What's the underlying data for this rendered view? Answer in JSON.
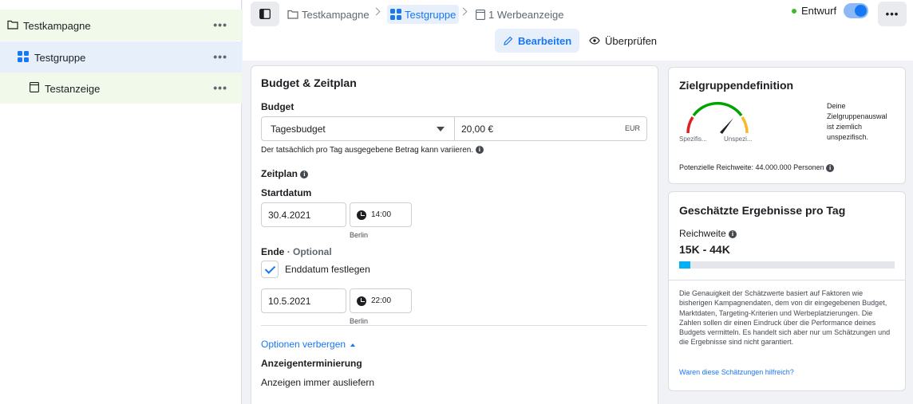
{
  "sidebar": {
    "items": [
      {
        "label": "Testkampagne",
        "more": "•••"
      },
      {
        "label": "Testgruppe",
        "more": "•••"
      },
      {
        "label": "Testanzeige",
        "more": "•••"
      }
    ]
  },
  "topbar": {
    "breadcrumbs": [
      "Testkampagne",
      "Testgruppe",
      "1 Werbeanzeige"
    ],
    "status": "Entwurf",
    "status_toggle_on": true,
    "more": "•••",
    "tabs": [
      "Bearbeiten",
      "Überprüfen"
    ],
    "active_tab": "Bearbeiten"
  },
  "budget_card": {
    "title": "Budget & Zeitplan",
    "budget_label": "Budget",
    "budget_type": "Tagesbudget",
    "budget_amount": "20,00 €",
    "currency": "EUR",
    "budget_note": "Der tatsächlich pro Tag ausgegebene Betrag kann variieren.",
    "schedule_label": "Zeitplan",
    "start_label": "Startdatum",
    "start_date": "30.4.2021",
    "start_time": "14:00",
    "start_tz": "Berlin",
    "end_label": "Ende",
    "end_optional": "· Optional",
    "end_checkbox_label": "Enddatum festlegen",
    "end_checked": true,
    "end_date": "10.5.2021",
    "end_time": "22:00",
    "end_tz": "Berlin",
    "options_link": "Optionen verbergen",
    "delivery_label": "Anzeigenterminierung",
    "delivery_value": "Anzeigen immer ausliefern"
  },
  "audience_card": {
    "title": "Zielgruppendefinition",
    "gauge_left": "Spezifis...",
    "gauge_right": "Unspezi...",
    "description": [
      "Deine",
      "Zielgruppenauswal",
      "ist ziemlich",
      "unspezifisch."
    ],
    "reach_text": "Potenzielle Reichweite: 44.000.000 Personen",
    "colors": {
      "specific": "#e02020",
      "good": "#00a400",
      "broad": "#f7b928"
    }
  },
  "estimate_card": {
    "title": "Geschätzte Ergebnisse pro Tag",
    "reach_label": "Reichweite",
    "reach_value": "15K - 44K",
    "bar_fill_fraction": 0.05,
    "disclaimer": "Die Genauigkeit der Schätzwerte basiert auf Faktoren wie bisherigen Kampagnendaten, dem von dir eingegebenen Budget, Marktdaten, Targeting-Kriterien und Werbeplatzierungen. Die Zahlen sollen dir einen Eindruck über die Performance deines Budgets vermitteln. Es handelt sich aber nur um Schätzungen und die Ergebnisse sind nicht garantiert.",
    "feedback_link": "Waren diese Schätzungen hilfreich?"
  }
}
